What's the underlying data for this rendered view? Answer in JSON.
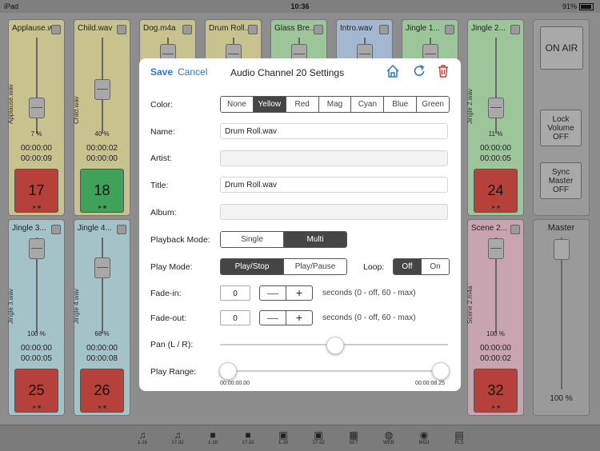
{
  "status": {
    "carrier": "iPad",
    "time": "10:36",
    "battery": "91%"
  },
  "channels_top": [
    {
      "name": "Applause.wav",
      "vname": "Applause.wav",
      "pct": "7 %",
      "t1": "00:00:00",
      "t2": "00:00:09",
      "num": "17",
      "color": "#c8c28e",
      "pad": "#b6413a"
    },
    {
      "name": "Child.wav",
      "vname": "Child.wav",
      "pct": "40 %",
      "t1": "00:00:02",
      "t2": "00:00:00",
      "num": "18",
      "color": "#c8c28e",
      "pad": "#3fa15a"
    },
    {
      "name": "Dog.m4a",
      "color": "#c8c28e"
    },
    {
      "name": "Drum Roll...",
      "color": "#c8c28e"
    },
    {
      "name": "Glass Bre...",
      "color": "#9cc59a"
    },
    {
      "name": "Intro.wav",
      "color": "#a3b8d0"
    },
    {
      "name": "Jingle 1...",
      "color": "#9cc59a"
    },
    {
      "name": "Jingle 2...",
      "vname": "Jingle 2.wav",
      "pct": "11 %",
      "t1": "00:00:00",
      "t2": "00:00:05",
      "num": "24",
      "color": "#9cc59a",
      "pad": "#b6413a"
    }
  ],
  "channels_bottom": [
    {
      "name": "Jingle 3...",
      "vname": "Jingle 3.wav",
      "pct": "100 %",
      "t1": "00:00:00",
      "t2": "00:00:05",
      "num": "25",
      "color": "#a3c3c8",
      "pad": "#b6413a"
    },
    {
      "name": "Jingle 4...",
      "vname": "Jingle 4.wav",
      "pct": "68 %",
      "t1": "00:00:00",
      "t2": "00:00:08",
      "num": "26",
      "color": "#a3c3c8",
      "pad": "#b6413a"
    },
    {
      "name": "Scene 2...",
      "vname": "Scene 2.m4a",
      "pct": "100 %",
      "t1": "00:00:00",
      "t2": "00:00:02",
      "num": "32",
      "color": "#c8a3b0",
      "pad": "#b6413a"
    }
  ],
  "side": {
    "on_air": "ON AIR",
    "lock_volume": "Lock Volume OFF",
    "sync_master": "Sync Master OFF",
    "master": "Master",
    "master_pct": "100 %"
  },
  "tabs": [
    {
      "icon": "♫",
      "label": "1-16"
    },
    {
      "icon": "♫",
      "label": "17-32"
    },
    {
      "icon": "■",
      "label": "1-16"
    },
    {
      "icon": "■",
      "label": "17-32"
    },
    {
      "icon": "▣",
      "label": "1-16"
    },
    {
      "icon": "▣",
      "label": "17-32"
    },
    {
      "icon": "▦",
      "label": "SET"
    },
    {
      "icon": "◍",
      "label": "WEB"
    },
    {
      "icon": "◉",
      "label": "MIDI"
    },
    {
      "icon": "▤",
      "label": "PLS"
    }
  ],
  "dialog": {
    "save": "Save",
    "cancel": "Cancel",
    "title": "Audio Channel 20 Settings",
    "labels": {
      "color": "Color:",
      "name": "Name:",
      "artist": "Artist:",
      "title": "Title:",
      "album": "Album:",
      "playback_mode": "Playback Mode:",
      "play_mode": "Play Mode:",
      "loop": "Loop:",
      "fade_in": "Fade-in:",
      "fade_out": "Fade-out:",
      "pan": "Pan (L / R):",
      "play_range": "Play Range:"
    },
    "colors": [
      "None",
      "Yellow",
      "Red",
      "Mag",
      "Cyan",
      "Blue",
      "Green"
    ],
    "selected_color": "Yellow",
    "name_value": "Drum Roll.wav",
    "artist_value": "",
    "title_value": "Drum Roll.wav",
    "album_value": "",
    "playback_modes": [
      "Single",
      "Multi"
    ],
    "playback_selected": "Multi",
    "play_modes": [
      "Play/Stop",
      "Play/Pause"
    ],
    "play_selected": "Play/Stop",
    "loop_options": [
      "Off",
      "On"
    ],
    "loop_selected": "Off",
    "fade_in_value": "0",
    "fade_out_value": "0",
    "minus": "—",
    "plus": "+",
    "fade_hint": "seconds (0 - off, 60 - max)",
    "pan_fraction": 0.5,
    "range_start": "00:00:00.00",
    "range_end": "00:00:08.25"
  }
}
